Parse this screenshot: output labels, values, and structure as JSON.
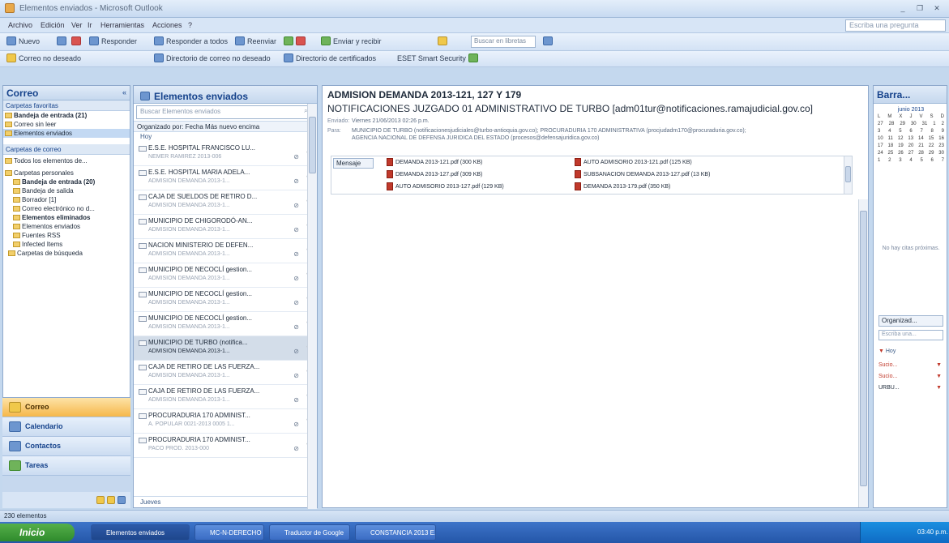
{
  "window": {
    "title": "Elementos enviados - Microsoft Outlook",
    "controls": [
      "_",
      "❐",
      "✕"
    ]
  },
  "menu": {
    "items": [
      "Archivo",
      "Edición",
      "Ver",
      "Ir",
      "Herramientas",
      "Acciones",
      "?"
    ],
    "help_placeholder": "Escriba una pregunta"
  },
  "toolbar1": {
    "new": "Nuevo",
    "reply": "Responder",
    "reply_all": "Responder a todos",
    "forward": "Reenviar",
    "send_receive": "Enviar y recibir",
    "search_placeholder": "Buscar en libretas"
  },
  "toolbar2": {
    "back": "Correo no deseado",
    "directory": "Directorio de correo no deseado",
    "directory2": "Directorio de certificados",
    "security": "ESET Smart Security"
  },
  "nav": {
    "title": "Correo",
    "favorites_header": "Carpetas favoritas",
    "favorites": [
      "Bandeja de entrada (21)",
      "Correo sin leer",
      "Elementos enviados"
    ],
    "mail_header": "Carpetas de correo",
    "all_items": "Todos los elementos de...",
    "tree": [
      "Carpetas personales",
      "Bandeja de entrada (20)",
      "Bandeja de salida",
      "Borrador [1]",
      "Correo electrónico no d...",
      "Elementos eliminados",
      "Elementos enviados",
      "Fuentes RSS",
      "Infected Items",
      "Carpetas de búsqueda"
    ],
    "buttons": [
      "Correo",
      "Calendario",
      "Contactos",
      "Tareas"
    ]
  },
  "list": {
    "title": "Elementos enviados",
    "search_placeholder": "Buscar Elementos enviados",
    "sort": "Organizado por: Fecha   Más nuevo encima",
    "group": "Hoy",
    "footer_group": "Jueves",
    "rows": [
      {
        "from": "E.S.E. HOSPITAL FRANCISCO LU...",
        "subj": "NEMER RAMIREZ 2013-006"
      },
      {
        "from": "E.S.E. HOSPITAL MARIA ADELA...",
        "subj": "ADMISION DEMANDA 2013-1..."
      },
      {
        "from": "CAJA DE SUELDOS DE RETIRO D...",
        "subj": "ADMISION DEMANDA 2013-1..."
      },
      {
        "from": "MUNICIPIO DE CHIGORODÓ-AN...",
        "subj": "ADMISION DEMANDA 2013-1..."
      },
      {
        "from": "NACION MINISTERIO DE DEFEN...",
        "subj": "ADMISION DEMANDA 2013-1..."
      },
      {
        "from": "MUNICIPIO DE NECOCLÍ gestion...",
        "subj": "ADMISION DEMANDA 2013-1..."
      },
      {
        "from": "MUNICIPIO DE NECOCLÍ gestion...",
        "subj": "ADMISION DEMANDA 2013-1..."
      },
      {
        "from": "MUNICIPIO DE NECOCLÍ gestion...",
        "subj": "ADMISION DEMANDA 2013-1..."
      },
      {
        "from": "MUNICIPIO DE TURBO (notifica...",
        "subj": "ADMISION DEMANDA 2013-1..."
      },
      {
        "from": "CAJA DE RETIRO DE LAS FUERZA...",
        "subj": "ADMISION DEMANDA 2013-1..."
      },
      {
        "from": "CAJA DE RETIRO DE LAS FUERZA...",
        "subj": "ADMISION DEMANDA 2013-1..."
      },
      {
        "from": "PROCURADURIA 170 ADMINIST...",
        "subj": "A. POPULAR 0021-2013 0005 1..."
      },
      {
        "from": "PROCURADURIA 170 ADMINIST...",
        "subj": "PACO PROD. 2013-000"
      }
    ],
    "selected_index": 8
  },
  "read": {
    "subject": "ADMISION DEMANDA 2013-121, 127 Y 179",
    "from": "NOTIFICACIONES JUZGADO 01 ADMINISTRATIVO DE TURBO [adm01tur@notificaciones.ramajudicial.gov.co]",
    "sent_label": "Enviado:",
    "sent": "Viernes 21/06/2013 02:26 p.m.",
    "to_label": "Para:",
    "to1": "MUNICIPIO DE TURBO (notificacionesjudiciales@turbo-antioquia.gov.co); PROCURADURIA 170 ADMINISTRATIVA (procjudadm170@procuraduria.gov.co);",
    "to2": "AGENCIA NACIONAL DE DEFENSA JURIDICA DEL ESTADO (procesos@defensajuridica.gov.co)",
    "message_btn": "Mensaje",
    "attachments": [
      "DEMANDA 2013-121.pdf (300 KB)",
      "AUTO ADMISORIO 2013-121.pdf (125 KB)",
      "DEMANDA 2013-127.pdf (309 KB)",
      "SUBSANACION DEMANDA 2013-127.pdf (13 KB)",
      "AUTO ADMISORIO 2013-127.pdf (129 KB)",
      "DEMANDA 2013-179.pdf (350 KB)"
    ]
  },
  "todo": {
    "title": "Barra...",
    "month": "junio 2013",
    "days_header": [
      "L",
      "M",
      "X",
      "J",
      "V",
      "S",
      "D"
    ],
    "weeks": [
      [
        "27",
        "28",
        "29",
        "30",
        "31",
        "1",
        "2"
      ],
      [
        "3",
        "4",
        "5",
        "6",
        "7",
        "8",
        "9"
      ],
      [
        "10",
        "11",
        "12",
        "13",
        "14",
        "15",
        "16"
      ],
      [
        "17",
        "18",
        "19",
        "20",
        "21",
        "22",
        "23"
      ],
      [
        "24",
        "25",
        "26",
        "27",
        "28",
        "29",
        "30"
      ],
      [
        "1",
        "2",
        "3",
        "4",
        "5",
        "6",
        "7"
      ]
    ],
    "no_appts": "No hay citas próximas.",
    "arrange": "Organizad...",
    "task_input": "Escriba una...",
    "today": "Hoy",
    "tasks": [
      "Sucio...",
      "Sucio...",
      "URBU..."
    ]
  },
  "status": {
    "text": "230 elementos"
  },
  "taskbar": {
    "start": "Inicio",
    "buttons": [
      "Elementos enviados",
      "MC-N-DERECHO",
      "Traductor de Google",
      "CONSTANCIA 2013 E..."
    ],
    "clock": "03:40 p.m."
  }
}
